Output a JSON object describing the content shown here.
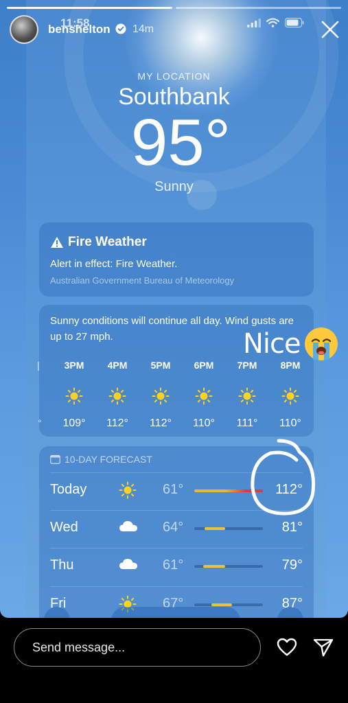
{
  "story": {
    "time": "11:58",
    "username": "benshelton",
    "posted_ago": "14m"
  },
  "weather": {
    "location_label": "MY LOCATION",
    "city": "Southbank",
    "temperature": "95°",
    "condition": "Sunny"
  },
  "alert": {
    "title": "Fire Weather",
    "text": "Alert in effect: Fire Weather.",
    "source": "Australian Government Bureau of Meteorology"
  },
  "hourly": {
    "summary": "Sunny conditions will continue all day. Wind gusts are up to 27 mph.",
    "hours": [
      {
        "label": "3PM",
        "temp": "109°"
      },
      {
        "label": "4PM",
        "temp": "112°"
      },
      {
        "label": "5PM",
        "temp": "112°"
      },
      {
        "label": "6PM",
        "temp": "110°"
      },
      {
        "label": "7PM",
        "temp": "111°"
      },
      {
        "label": "8PM",
        "temp": "110°"
      }
    ]
  },
  "forecast": {
    "header": "10-DAY FORECAST",
    "days": [
      {
        "day": "Today",
        "icon": "sun-icon",
        "low": "61°",
        "high": "112°"
      },
      {
        "day": "Wed",
        "icon": "cloud-icon",
        "low": "64°",
        "high": "81°"
      },
      {
        "day": "Thu",
        "icon": "cloud-icon",
        "low": "61°",
        "high": "79°"
      },
      {
        "day": "Fri",
        "icon": "sun-icon",
        "low": "67°",
        "high": "87°"
      }
    ]
  },
  "overlay": {
    "caption": "Nice"
  },
  "reply": {
    "placeholder": "Send message..."
  },
  "colors": {
    "sun": "#ffd21f",
    "today_range": "#f0b43c",
    "today_hot": "#e03a3a",
    "range_bar": "#e8c43a"
  }
}
